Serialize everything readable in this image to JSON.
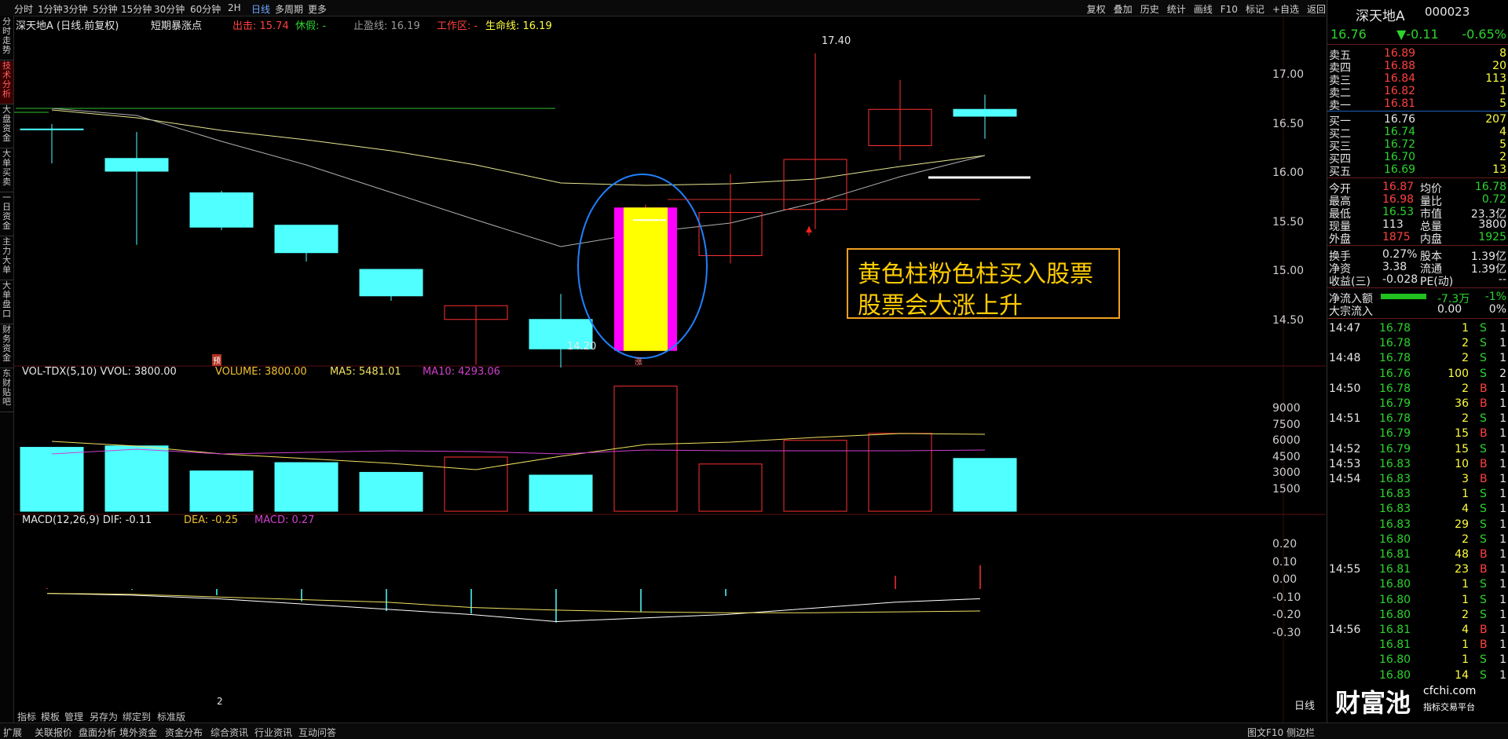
{
  "toolbar": {
    "tabs": [
      "分时",
      "1分钟",
      "3分钟",
      "5分钟",
      "15分钟",
      "30分钟",
      "60分钟",
      "2H",
      "日线",
      "多周期",
      "更多"
    ],
    "active_tab": "日线",
    "right_tools": [
      "复权",
      "叠加",
      "历史",
      "统计",
      "画线",
      "F10",
      "标记",
      "+自选",
      "返回"
    ]
  },
  "left_tabs": [
    "分时走势",
    "技术分析",
    "大盘资金",
    "大单买卖",
    "一日资金",
    "主力大单",
    "大单盘口",
    "财务资金",
    "东财贴吧"
  ],
  "main_chart": {
    "stock_label": "深天地A (日线.前复权)",
    "indicator": "短期暴涨点",
    "exit_label": "出击: 15.74",
    "rest_label": "休假: -",
    "stop_label": "止盈线: 16.19",
    "work_label": "工作区: -",
    "life_label": "生命线: 16.19",
    "high_marker": "17.40",
    "low_marker": "14.20",
    "pre_marker": "预",
    "rise_marker": "涨",
    "price_axis": [
      "17.00",
      "16.50",
      "16.00",
      "15.50",
      "15.00",
      "14.50"
    ]
  },
  "volume_panel": {
    "title": "VOL-TDX(5,10) VVOL: 3800.00",
    "volume": "VOLUME: 3800.00",
    "ma5": "MA5: 5481.01",
    "ma10": "MA10: 4293.06",
    "axis": [
      "9000",
      "7500",
      "6000",
      "4500",
      "3000",
      "1500"
    ]
  },
  "macd_panel": {
    "title": "MACD(12,26,9) DIF: -0.11",
    "dea": "DEA: -0.25",
    "macd": "MACD: 0.27",
    "axis": [
      "0.20",
      "0.10",
      "0.00",
      "-0.10",
      "-0.20",
      "-0.30"
    ]
  },
  "annotation": {
    "line1": "黄色柱粉色柱买入股票",
    "line2": "股票会大涨上升"
  },
  "chart_data": {
    "type": "candlestick",
    "title": "深天地A (日线.前复权)",
    "candles": [
      {
        "open": 16.63,
        "close": 16.63,
        "high": 16.68,
        "low": 16.28,
        "up": false
      },
      {
        "open": 16.33,
        "close": 16.2,
        "high": 16.6,
        "low": 15.45,
        "up": false
      },
      {
        "open": 15.98,
        "close": 15.63,
        "high": 16.0,
        "low": 15.6,
        "up": false
      },
      {
        "open": 15.65,
        "close": 15.37,
        "high": 15.65,
        "low": 15.28,
        "up": false
      },
      {
        "open": 15.2,
        "close": 14.93,
        "high": 15.2,
        "low": 14.88,
        "up": false
      },
      {
        "open": 14.69,
        "close": 14.83,
        "high": 14.83,
        "low": 14.23,
        "up": true
      },
      {
        "open": 14.69,
        "close": 14.39,
        "high": 14.95,
        "low": 14.2,
        "up": false
      },
      {
        "open": 14.37,
        "close": 15.83,
        "high": 15.86,
        "low": 14.37,
        "up": true,
        "signal": true
      },
      {
        "open": 15.34,
        "close": 15.78,
        "high": 16.17,
        "low": 15.26,
        "up": true
      },
      {
        "open": 15.81,
        "close": 16.32,
        "high": 17.4,
        "low": 15.61,
        "up": true
      },
      {
        "open": 16.46,
        "close": 16.83,
        "high": 17.13,
        "low": 16.31,
        "up": true
      },
      {
        "open": 16.83,
        "close": 16.76,
        "high": 16.98,
        "low": 16.53,
        "up": false
      }
    ],
    "volume": [
      4600,
      4700,
      2900,
      3500,
      2800,
      3900,
      2600,
      9000,
      3400,
      5100,
      5600,
      3800
    ],
    "macd_hist": [
      0.01,
      -0.01,
      -0.07,
      -0.14,
      -0.25,
      -0.28,
      -0.38,
      -0.26,
      -0.08,
      0.0,
      0.15,
      0.27
    ],
    "dif": [
      -0.05,
      -0.07,
      -0.11,
      -0.17,
      -0.23,
      -0.29,
      -0.37,
      -0.33,
      -0.29,
      -0.22,
      -0.15,
      -0.11
    ],
    "dea": [
      -0.05,
      -0.06,
      -0.09,
      -0.12,
      -0.15,
      -0.21,
      -0.24,
      -0.26,
      -0.27,
      -0.27,
      -0.26,
      -0.25
    ],
    "ylim": [
      14.2,
      17.4
    ]
  },
  "quote": {
    "name": "深天地A",
    "code": "000023",
    "price": "16.76",
    "change": "▼-0.11",
    "pct": "-0.65%",
    "asks": [
      {
        "label": "卖五",
        "price": "16.89",
        "vol": "8"
      },
      {
        "label": "卖四",
        "price": "16.88",
        "vol": "20"
      },
      {
        "label": "卖三",
        "price": "16.84",
        "vol": "113"
      },
      {
        "label": "卖二",
        "price": "16.82",
        "vol": "1"
      },
      {
        "label": "卖一",
        "price": "16.81",
        "vol": "5"
      }
    ],
    "bids": [
      {
        "label": "买一",
        "price": "16.76",
        "vol": "207"
      },
      {
        "label": "买二",
        "price": "16.74",
        "vol": "4"
      },
      {
        "label": "买三",
        "price": "16.72",
        "vol": "5"
      },
      {
        "label": "买四",
        "price": "16.70",
        "vol": "2"
      },
      {
        "label": "买五",
        "price": "16.69",
        "vol": "13"
      }
    ],
    "stats": [
      {
        "k1": "今开",
        "v1": "16.87",
        "k2": "均价",
        "v2": "16.78",
        "c1": "red",
        "c2": "green"
      },
      {
        "k1": "最高",
        "v1": "16.98",
        "k2": "量比",
        "v2": "0.72",
        "c1": "red",
        "c2": "green"
      },
      {
        "k1": "最低",
        "v1": "16.53",
        "k2": "市值",
        "v2": "23.3亿",
        "c1": "green",
        "c2": "white"
      },
      {
        "k1": "现量",
        "v1": "113",
        "k2": "总量",
        "v2": "3800",
        "c1": "white",
        "c2": "white"
      },
      {
        "k1": "外盘",
        "v1": "1875",
        "k2": "内盘",
        "v2": "1925",
        "c1": "red",
        "c2": "green"
      }
    ],
    "stats2": [
      {
        "k1": "换手",
        "v1": "0.27%",
        "k2": "股本",
        "v2": "1.39亿"
      },
      {
        "k1": "净资",
        "v1": "3.38",
        "k2": "流通",
        "v2": "1.39亿"
      },
      {
        "k1": "收益(三)",
        "v1": "-0.028",
        "k2": "PE(动)",
        "v2": "--"
      }
    ],
    "flow_label": "净流入额",
    "flow_value": "-7.3万",
    "flow_pct": "-1%",
    "block_label": "大宗流入",
    "block_value": "0.00",
    "block_pct": "0%"
  },
  "ticks": [
    {
      "t": "14:47",
      "p": "16.78",
      "v": "1",
      "s": "S",
      "n": "1"
    },
    {
      "t": "",
      "p": "16.78",
      "v": "2",
      "s": "S",
      "n": "1"
    },
    {
      "t": "14:48",
      "p": "16.78",
      "v": "2",
      "s": "S",
      "n": "1"
    },
    {
      "t": "",
      "p": "16.76",
      "v": "100",
      "s": "S",
      "n": "2"
    },
    {
      "t": "14:50",
      "p": "16.78",
      "v": "2",
      "s": "B",
      "n": "1"
    },
    {
      "t": "",
      "p": "16.79",
      "v": "36",
      "s": "B",
      "n": "1"
    },
    {
      "t": "14:51",
      "p": "16.78",
      "v": "2",
      "s": "S",
      "n": "1"
    },
    {
      "t": "",
      "p": "16.79",
      "v": "15",
      "s": "B",
      "n": "1"
    },
    {
      "t": "14:52",
      "p": "16.79",
      "v": "15",
      "s": "S",
      "n": "1"
    },
    {
      "t": "14:53",
      "p": "16.83",
      "v": "10",
      "s": "B",
      "n": "1"
    },
    {
      "t": "14:54",
      "p": "16.83",
      "v": "3",
      "s": "B",
      "n": "1"
    },
    {
      "t": "",
      "p": "16.83",
      "v": "1",
      "s": "S",
      "n": "1"
    },
    {
      "t": "",
      "p": "16.83",
      "v": "4",
      "s": "S",
      "n": "1"
    },
    {
      "t": "",
      "p": "16.83",
      "v": "29",
      "s": "S",
      "n": "1"
    },
    {
      "t": "",
      "p": "16.80",
      "v": "2",
      "s": "S",
      "n": "1"
    },
    {
      "t": "",
      "p": "16.81",
      "v": "48",
      "s": "B",
      "n": "1"
    },
    {
      "t": "14:55",
      "p": "16.81",
      "v": "23",
      "s": "B",
      "n": "1"
    },
    {
      "t": "",
      "p": "16.80",
      "v": "1",
      "s": "S",
      "n": "1"
    },
    {
      "t": "",
      "p": "16.80",
      "v": "1",
      "s": "S",
      "n": "1"
    },
    {
      "t": "",
      "p": "16.80",
      "v": "2",
      "s": "S",
      "n": "1"
    },
    {
      "t": "14:56",
      "p": "16.81",
      "v": "4",
      "s": "B",
      "n": "1"
    },
    {
      "t": "",
      "p": "16.81",
      "v": "1",
      "s": "B",
      "n": "1"
    },
    {
      "t": "",
      "p": "16.80",
      "v": "1",
      "s": "S",
      "n": "1"
    },
    {
      "t": "",
      "p": "16.80",
      "v": "14",
      "s": "S",
      "n": "1"
    }
  ],
  "bottom_subtabs": [
    "指标",
    "模板",
    "管理",
    "另存为",
    "绑定到",
    "标准版"
  ],
  "bottom_bar": [
    "扩展",
    "关联报价",
    "盘面分析",
    "境外资金",
    "资金分布",
    "综合资讯",
    "行业资讯",
    "互动问答"
  ],
  "bottom_right": "图文F10 侧边栏",
  "period_label": "日线",
  "page_num": "2",
  "logo": {
    "text": "财富池",
    "site": "cfchi.com",
    "sub": "指标交易平台"
  }
}
